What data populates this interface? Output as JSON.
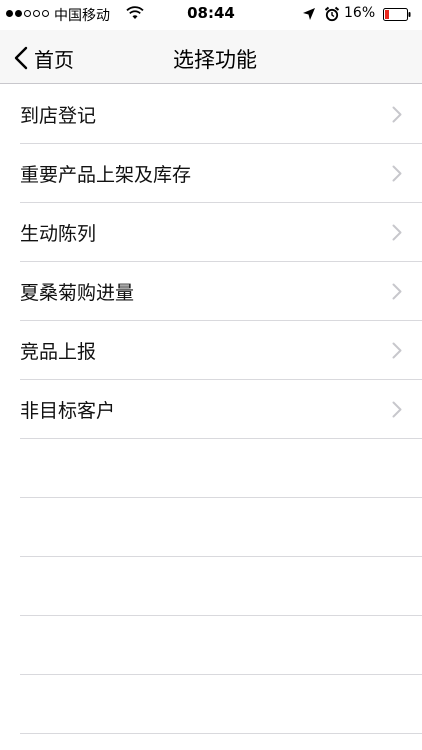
{
  "status_bar": {
    "carrier": "中国移动",
    "time": "08:44",
    "battery_percent": "16%"
  },
  "nav_bar": {
    "back_label": "首页",
    "title": "选择功能"
  },
  "menu": {
    "items": [
      {
        "label": "到店登记"
      },
      {
        "label": "重要产品上架及库存"
      },
      {
        "label": "生动陈列"
      },
      {
        "label": "夏桑菊购进量"
      },
      {
        "label": "竞品上报"
      },
      {
        "label": "非目标客户"
      }
    ],
    "empty_row_count": 5
  },
  "colors": {
    "separator": "#d9d9dd",
    "chevron": "#c7c7cc",
    "battery_low": "#e8291f"
  }
}
